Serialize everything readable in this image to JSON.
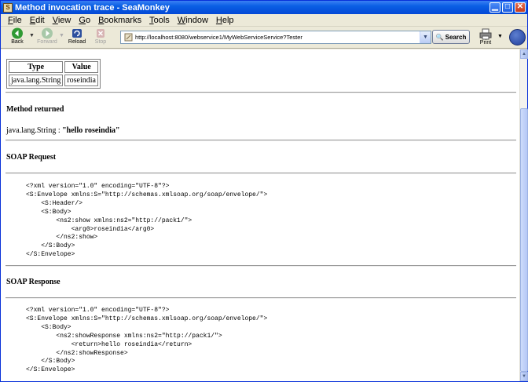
{
  "window": {
    "title": "Method invocation trace - SeaMonkey",
    "icon_letter": "S"
  },
  "menu": [
    {
      "key": "F",
      "rest": "ile"
    },
    {
      "key": "E",
      "rest": "dit"
    },
    {
      "key": "V",
      "rest": "iew"
    },
    {
      "key": "G",
      "rest": "o"
    },
    {
      "key": "B",
      "rest": "ookmarks"
    },
    {
      "key": "T",
      "rest": "ools"
    },
    {
      "key": "W",
      "rest": "indow"
    },
    {
      "key": "H",
      "rest": "elp"
    }
  ],
  "toolbar": {
    "back_label": "Back",
    "forward_label": "Forward",
    "reload_label": "Reload",
    "stop_label": "Stop",
    "url": "http://localhost:8080/webservice1/MyWebServiceService?Tester",
    "search_label": "Search",
    "print_label": "Print"
  },
  "params": {
    "headers": [
      "Type",
      "Value"
    ],
    "rows": [
      [
        "java.lang.String",
        "roseindia"
      ]
    ]
  },
  "method_returned": {
    "heading": "Method returned",
    "type": "java.lang.String :",
    "value": "\"hello roseindia\""
  },
  "soap_request": {
    "heading": "SOAP Request",
    "lines": [
      "<?xml version=\"1.0\" encoding=\"UTF-8\"?>",
      "<S:Envelope xmlns:S=\"http://schemas.xmlsoap.org/soap/envelope/\">",
      "    <S:Header/>",
      "    <S:Body>",
      "        <ns2:show xmlns:ns2=\"http://pack1/\">",
      "            <arg0>roseindia</arg0>",
      "        </ns2:show>",
      "    </S:Body>",
      "</S:Envelope>"
    ]
  },
  "soap_response": {
    "heading": "SOAP Response",
    "lines": [
      "<?xml version=\"1.0\" encoding=\"UTF-8\"?>",
      "<S:Envelope xmlns:S=\"http://schemas.xmlsoap.org/soap/envelope/\">",
      "    <S:Body>",
      "        <ns2:showResponse xmlns:ns2=\"http://pack1/\">",
      "            <return>hello roseindia</return>",
      "        </ns2:showResponse>",
      "    </S:Body>",
      "</S:Envelope>"
    ]
  }
}
